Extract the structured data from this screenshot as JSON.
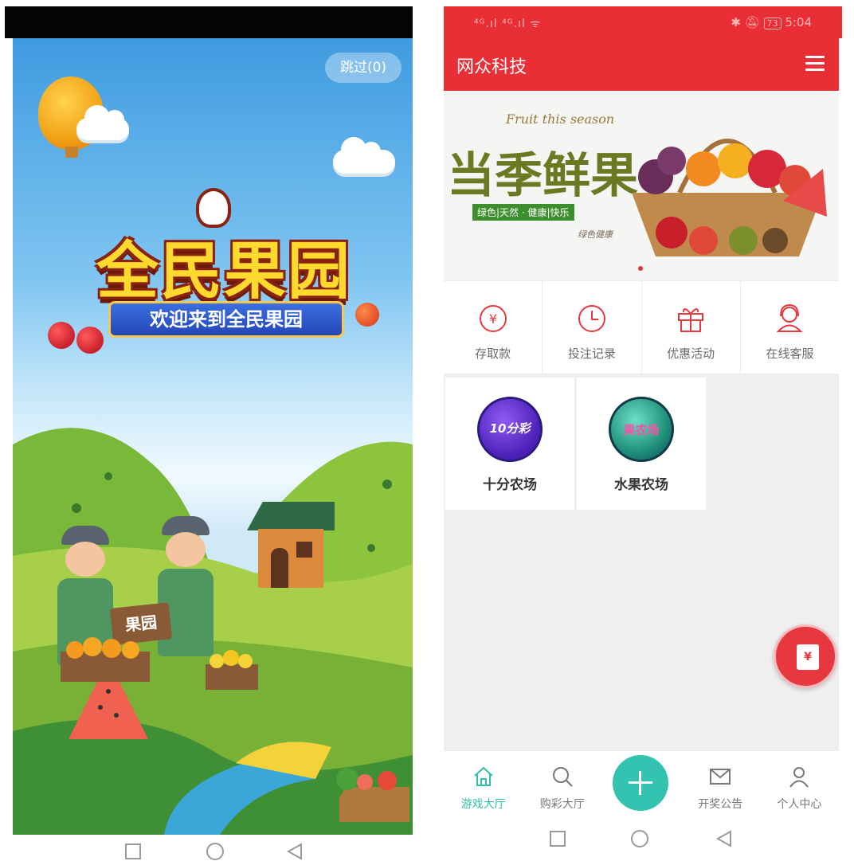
{
  "splash": {
    "skip_button": "跳过(0)",
    "logo_title": "全民果园",
    "welcome_text": "欢迎来到全民果园",
    "sign_text": "果园"
  },
  "app": {
    "status_bar": {
      "signal": "⁴ᴳ.ıl ⁴ᴳ.ıl ᯤ",
      "battery": "73",
      "time": "5:04"
    },
    "title": "网众科技",
    "banner": {
      "script_text": "Fruit this season",
      "headline": "当季鲜果",
      "tagline": "绿色|天然 · 健康|快乐",
      "signature": "绿色健康"
    },
    "quick_menu": [
      {
        "label": "存取款",
        "icon": "yen-circle-icon"
      },
      {
        "label": "投注记录",
        "icon": "clock-icon"
      },
      {
        "label": "优惠活动",
        "icon": "gift-icon"
      },
      {
        "label": "在线客服",
        "icon": "headset-icon"
      }
    ],
    "games": [
      {
        "label": "十分农场",
        "badge": "10分彩"
      },
      {
        "label": "水果农场",
        "badge": "果农场"
      }
    ],
    "tabs": [
      {
        "label": "游戏大厅",
        "icon": "home-icon",
        "active": true
      },
      {
        "label": "购彩大厅",
        "icon": "search-icon",
        "active": false
      },
      {
        "label": "",
        "icon": "plus-icon",
        "active": false
      },
      {
        "label": "开奖公告",
        "icon": "mail-icon",
        "active": false
      },
      {
        "label": "个人中心",
        "icon": "person-icon",
        "active": false
      }
    ]
  },
  "colors": {
    "brand_red": "#ea2e36",
    "accent_teal": "#33c3b0",
    "tab_active": "#2ec1a6"
  }
}
